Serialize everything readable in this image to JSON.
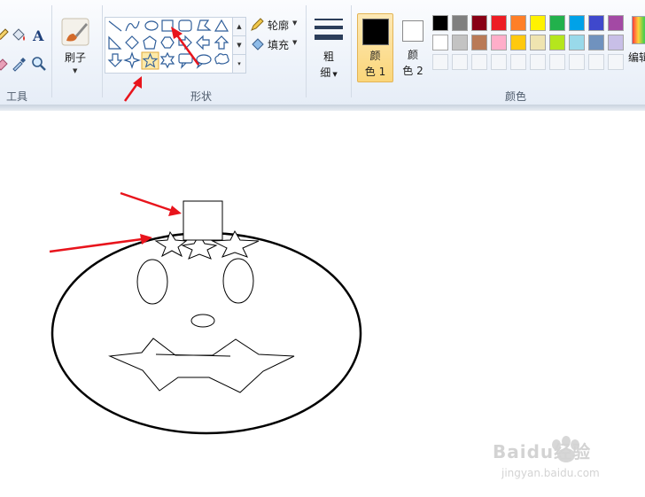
{
  "groups": {
    "tools_label": "工具",
    "shapes_label": "形状",
    "colors_label": "颜色"
  },
  "brush": {
    "label": "刷子"
  },
  "outline": {
    "label": "轮廓"
  },
  "fill": {
    "label": "填充"
  },
  "size": {
    "label_line1": "粗",
    "label_line2": "细"
  },
  "color1": {
    "label_line1": "颜",
    "label_line2": "色 1",
    "value": "#000000"
  },
  "color2": {
    "label_line1": "颜",
    "label_line2": "色 2",
    "value": "#ffffff"
  },
  "edit_colors": {
    "label": "编辑"
  },
  "palette_row1": [
    "#000000",
    "#7f7f7f",
    "#880015",
    "#ed1c24",
    "#ff7f27",
    "#fff200",
    "#22b14c",
    "#00a2e8",
    "#3f48cc",
    "#a349a4"
  ],
  "palette_row2": [
    "#ffffff",
    "#c3c3c3",
    "#b97a57",
    "#ffaec9",
    "#ffc90e",
    "#efe4b0",
    "#b5e61d",
    "#99d9ea",
    "#7092be",
    "#c8bfe7"
  ],
  "palette_row3_empty": 10,
  "shapes": [
    "line",
    "curve",
    "oval",
    "rectangle",
    "rounded-rectangle",
    "polygon",
    "triangle",
    "right-triangle",
    "diamond",
    "pentagon",
    "hexagon",
    "right-arrow",
    "left-arrow",
    "up-arrow",
    "down-arrow",
    "four-point-star",
    "five-point-star",
    "six-point-star",
    "rounded-callout",
    "oval-callout",
    "cloud-callout"
  ],
  "selected_shape": "five-point-star",
  "accent": "#e8141c",
  "watermark": {
    "brand": "Baidu经验",
    "url": "jingyan.baidu.com"
  }
}
